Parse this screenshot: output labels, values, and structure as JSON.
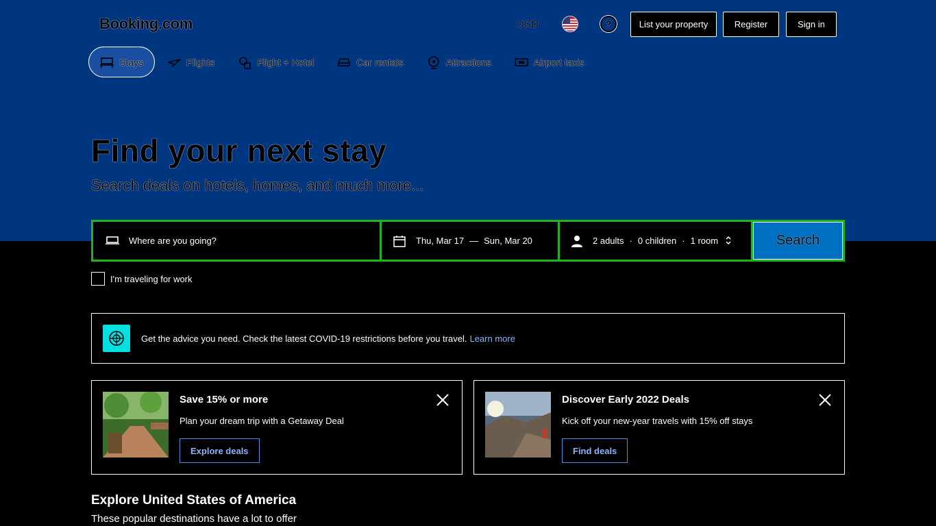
{
  "header": {
    "logo": "Booking.com",
    "currency": "USD",
    "list_property": "List your property",
    "register": "Register",
    "sign_in": "Sign in"
  },
  "nav": [
    {
      "label": "Stays",
      "icon": "bed-icon",
      "active": true
    },
    {
      "label": "Flights",
      "icon": "plane-icon",
      "active": false
    },
    {
      "label": "Flight + Hotel",
      "icon": "flight-hotel-icon",
      "active": false
    },
    {
      "label": "Car rentals",
      "icon": "car-icon",
      "active": false
    },
    {
      "label": "Attractions",
      "icon": "attractions-icon",
      "active": false
    },
    {
      "label": "Airport taxis",
      "icon": "taxi-icon",
      "active": false
    }
  ],
  "hero": {
    "title": "Find your next stay",
    "subtitle": "Search deals on hotels, homes, and much more..."
  },
  "search": {
    "destination_placeholder": "Where are you going?",
    "checkin": "Thu, Mar 17",
    "separator": "—",
    "checkout": "Sun, Mar 20",
    "adults": "2 adults",
    "children": "0 children",
    "rooms": "1 room",
    "dot": "·",
    "button": "Search"
  },
  "work_travel": "I'm traveling for work",
  "covid": {
    "text": "Get the advice you need. Check the latest COVID-19 restrictions before you travel.",
    "link": "Learn more"
  },
  "promos": [
    {
      "title": "Save 15% or more",
      "text": "Plan your dream trip with a Getaway Deal",
      "button": "Explore deals"
    },
    {
      "title": "Discover Early 2022 Deals",
      "text": "Kick off your new-year travels with 15% off stays",
      "button": "Find deals"
    }
  ],
  "explore": {
    "title": "Explore United States of America",
    "subtitle": "These popular destinations have a lot to offer"
  },
  "colors": {
    "brand_blue": "#003580",
    "search_button": "#0071c2",
    "search_border": "#1fb31f",
    "covid_icon_bg": "#00e0e0"
  }
}
